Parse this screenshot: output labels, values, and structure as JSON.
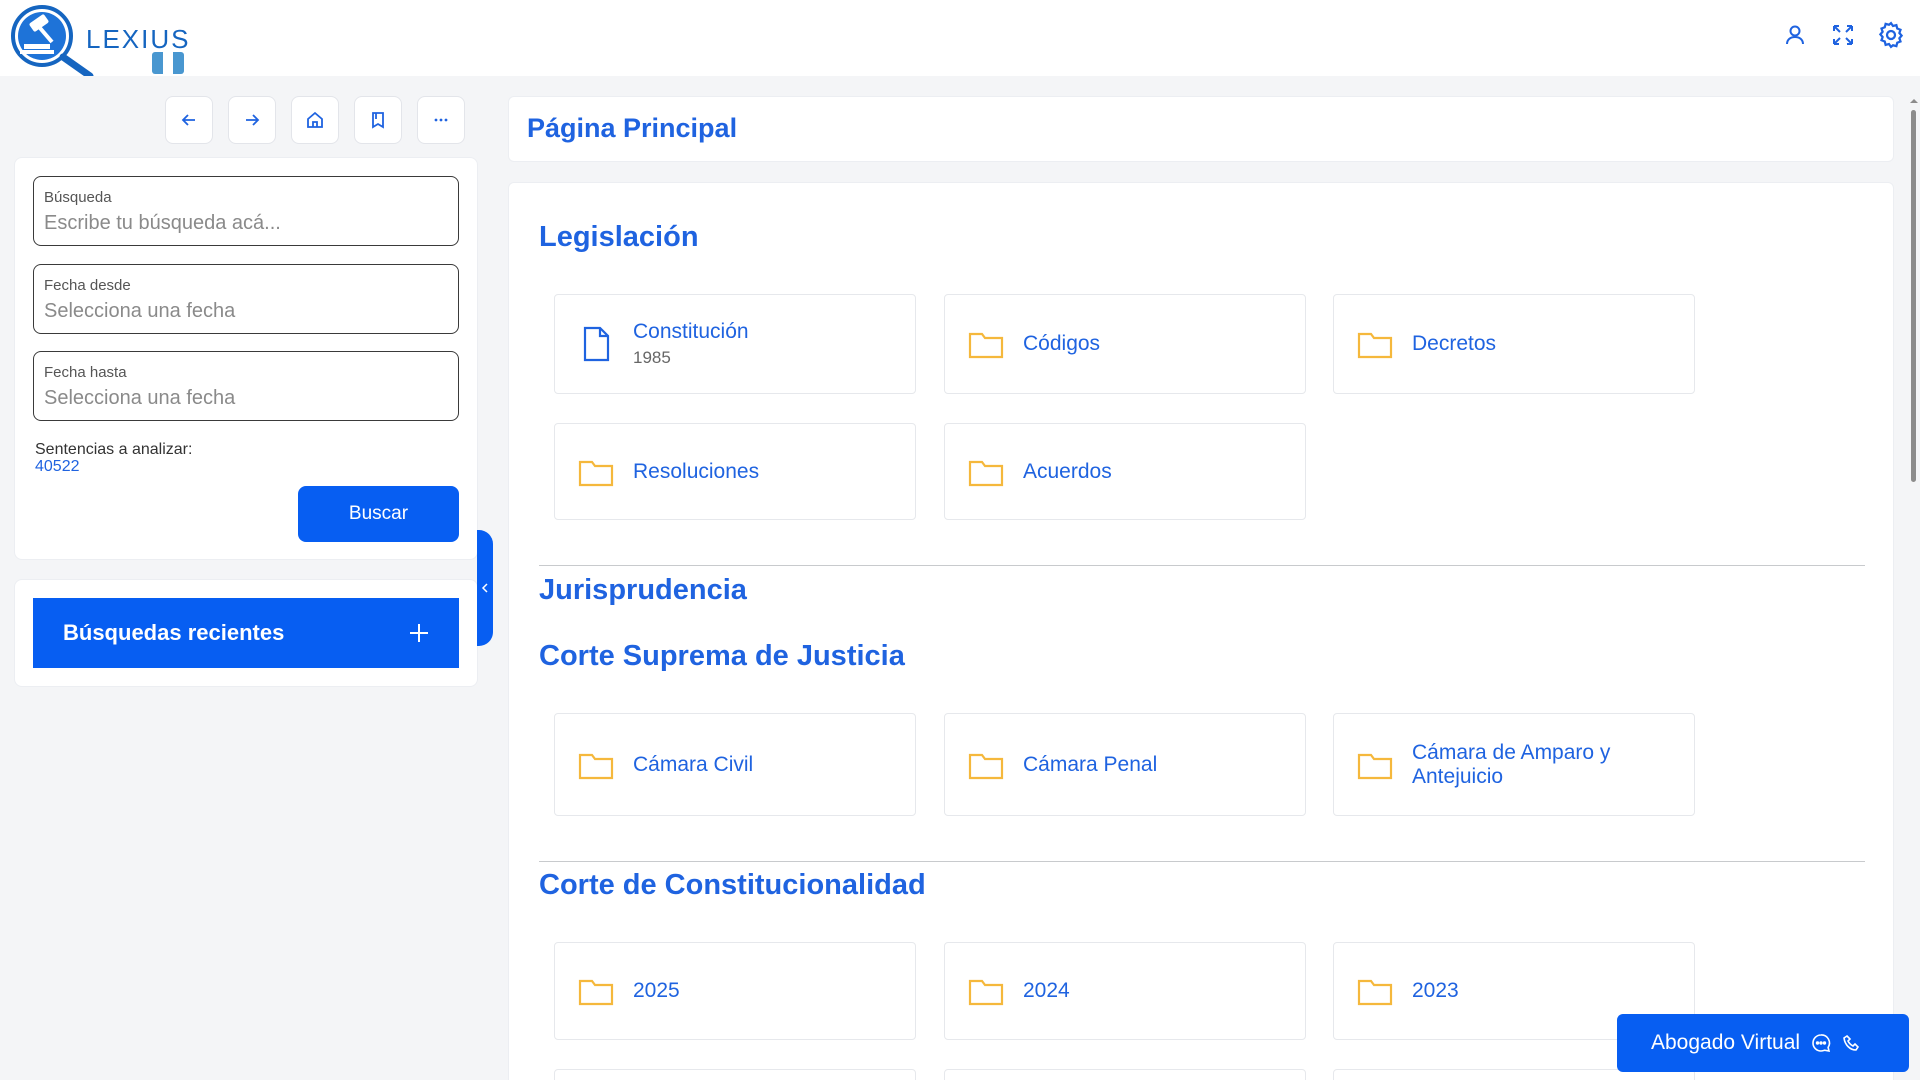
{
  "app": {
    "name": "LEXIUS"
  },
  "colors": {
    "primary": "#075ef2",
    "title_blue": "#1f63e0",
    "folder": "#f5b83c",
    "background": "#f4f5f7"
  },
  "header": {
    "icons": [
      "user-icon",
      "expand-icon",
      "settings-icon"
    ]
  },
  "toolbar": {
    "buttons": [
      "back-arrow-icon",
      "forward-arrow-icon",
      "home-icon",
      "bookmark-icon",
      "more-icon"
    ]
  },
  "search": {
    "query": {
      "label": "Búsqueda",
      "placeholder": "Escribe tu búsqueda acá...",
      "value": ""
    },
    "date_from": {
      "label": "Fecha desde",
      "placeholder": "Selecciona una fecha",
      "value": ""
    },
    "date_to": {
      "label": "Fecha hasta",
      "placeholder": "Selecciona una fecha",
      "value": ""
    },
    "count_label": "Sentencias a analizar:",
    "count_value": "40522",
    "button": "Buscar"
  },
  "recent": {
    "label": "Búsquedas recientes",
    "icon": "plus-icon"
  },
  "main": {
    "title": "Página Principal",
    "legislacion": {
      "title": "Legislación",
      "items": [
        {
          "label": "Constitución",
          "sub": "1985",
          "icon": "document-icon"
        },
        {
          "label": "Códigos",
          "icon": "folder-icon"
        },
        {
          "label": "Decretos",
          "icon": "folder-icon"
        },
        {
          "label": "Resoluciones",
          "icon": "folder-icon"
        },
        {
          "label": "Acuerdos",
          "icon": "folder-icon"
        }
      ]
    },
    "jurisprudencia": {
      "title": "Jurisprudencia",
      "csj": {
        "title": "Corte Suprema de Justicia",
        "items": [
          {
            "label": "Cámara Civil",
            "icon": "folder-icon"
          },
          {
            "label": "Cámara Penal",
            "icon": "folder-icon"
          },
          {
            "label": "Cámara de Amparo y Antejuicio",
            "icon": "folder-icon"
          }
        ]
      }
    },
    "cc": {
      "title": "Corte de Constitucionalidad",
      "items": [
        {
          "label": "2025",
          "icon": "folder-icon"
        },
        {
          "label": "2024",
          "icon": "folder-icon"
        },
        {
          "label": "2023",
          "icon": "folder-icon"
        }
      ]
    }
  },
  "chat": {
    "label": "Abogado Virtual",
    "icons": [
      "chat-bubble-icon",
      "phone-icon"
    ]
  }
}
